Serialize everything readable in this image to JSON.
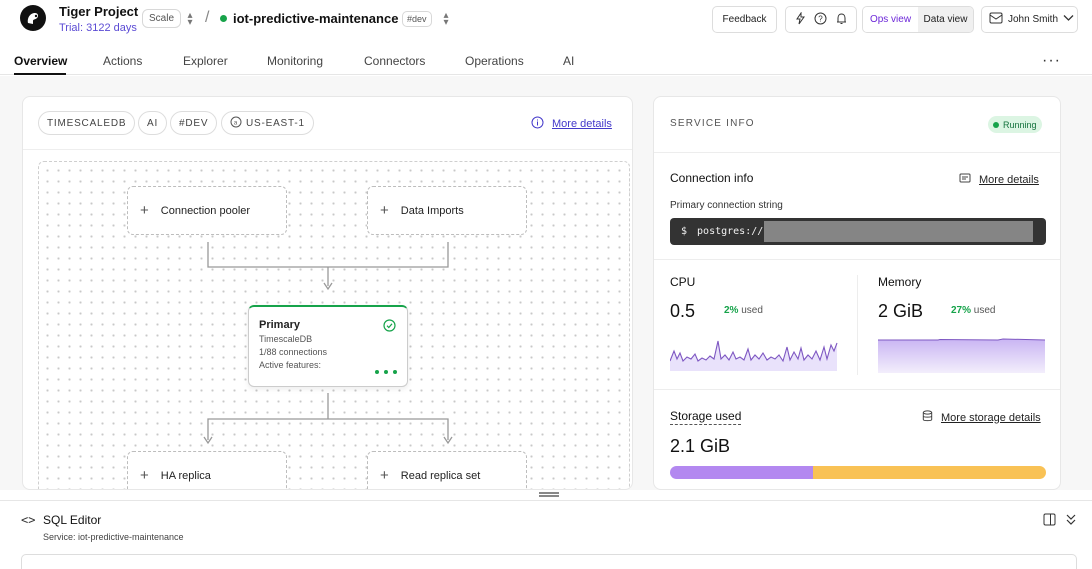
{
  "header": {
    "project_name": "Tiger Project",
    "trial": "Trial: 3122 days",
    "scale_badge": "Scale",
    "separator": "/",
    "service_name": "iot-predictive-maintenance",
    "env_badge": "#dev",
    "feedback": "Feedback",
    "ops_view": "Ops view",
    "data_view": "Data view",
    "user_name": "John Smith"
  },
  "tabs": [
    "Overview",
    "Actions",
    "Explorer",
    "Monitoring",
    "Connectors",
    "Operations",
    "AI"
  ],
  "left": {
    "chips": [
      "TIMESCALEDB",
      "AI",
      "#DEV",
      "US-EAST-1"
    ],
    "more_details": "More details",
    "nodes": {
      "pooler": "Connection pooler",
      "imports": "Data Imports",
      "ha": "HA replica",
      "read": "Read replica set"
    },
    "primary": {
      "title": "Primary",
      "engine": "TimescaleDB",
      "connections": "1/88 connections",
      "features": "Active features:"
    }
  },
  "right": {
    "section_label": "SERVICE INFO",
    "status": "Running",
    "connection_title": "Connection info",
    "connection_more": "More details",
    "conn_string_label": "Primary connection string",
    "conn_prompt": "$",
    "conn_value": "postgres://",
    "cpu": {
      "label": "CPU",
      "value": "0.5",
      "pct": "2%",
      "used": "used"
    },
    "memory": {
      "label": "Memory",
      "value": "2 GiB",
      "pct": "27%",
      "used": "used"
    },
    "storage": {
      "title": "Storage used",
      "value": "2.1 GiB",
      "more": "More storage details",
      "segments": [
        0.38,
        0.62
      ]
    }
  },
  "sql": {
    "title": "SQL Editor",
    "service": "Service: iot-predictive-maintenance"
  },
  "colors": {
    "accent": "#6d28d9",
    "link": "#4338ca",
    "green": "#16a34a",
    "storage_purple": "#b388f0",
    "storage_yellow": "#f9c255"
  }
}
